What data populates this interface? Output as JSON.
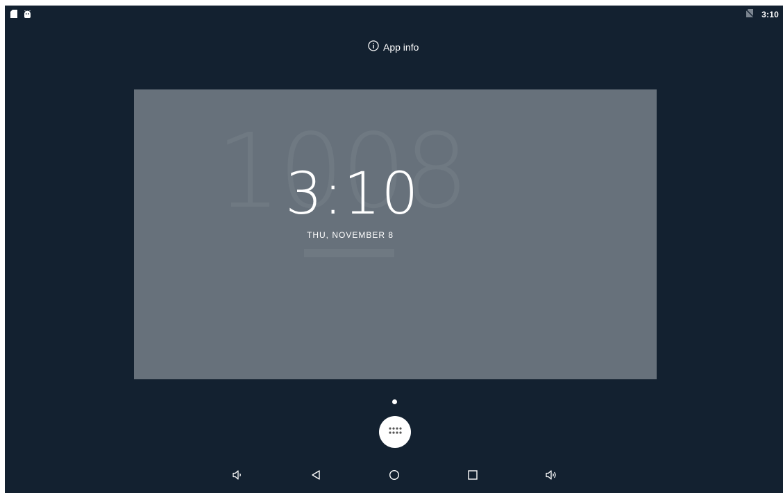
{
  "status_bar": {
    "left_icons": [
      "sd-card-icon",
      "android-debug-icon"
    ],
    "right_icons": [
      "no-sim-icon"
    ],
    "time": "3:10"
  },
  "app_info": {
    "label": "App info",
    "icon": "info-icon"
  },
  "widget": {
    "time": "3:10",
    "date": "THU, NOVEMBER 8",
    "background_color": "#67717b"
  },
  "page_indicator": {
    "current": 1,
    "total": 1
  },
  "all_apps_button": {
    "icon": "apps-grid-icon"
  },
  "nav_bar": {
    "buttons": [
      "volume-down-icon",
      "back-icon",
      "home-icon",
      "recents-icon",
      "volume-up-icon"
    ]
  },
  "colors": {
    "screen_background": "#132130",
    "foreground": "#ffffff"
  }
}
